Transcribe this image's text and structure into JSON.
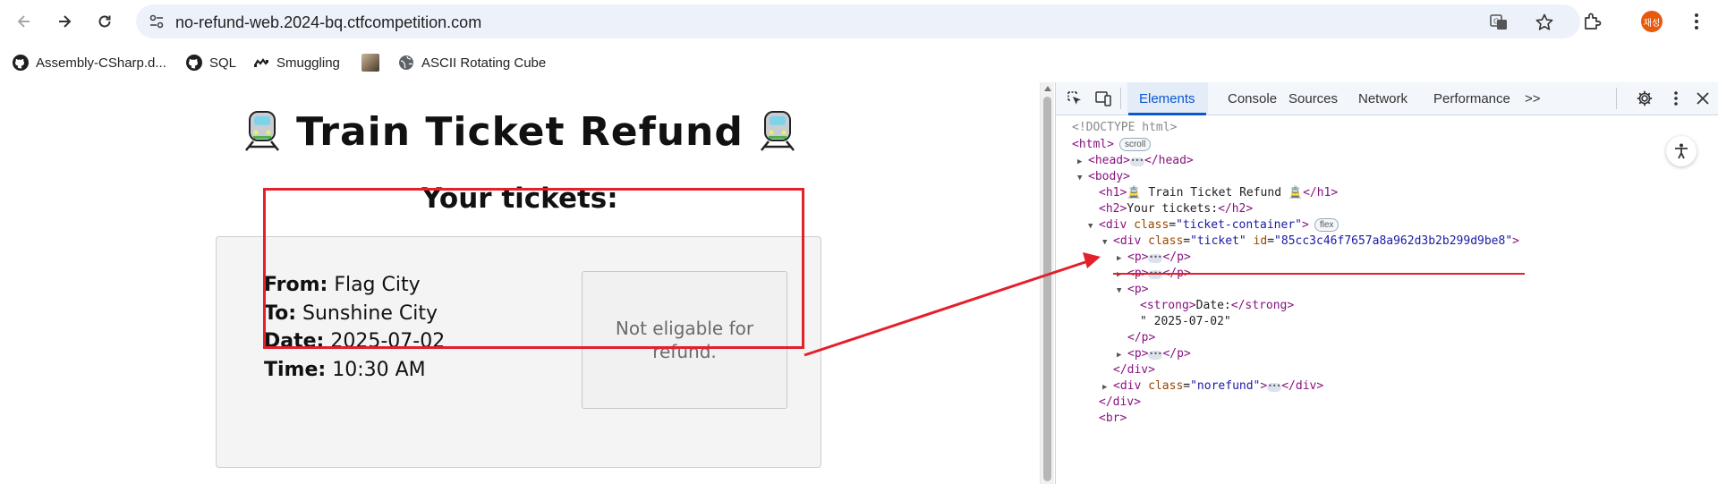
{
  "browser": {
    "url": "no-refund-web.2024-bq.ctfcompetition.com",
    "profile_initials": "재성"
  },
  "bookmarks": [
    {
      "label": "Assembly-CSharp.d...",
      "icon": "github-icon"
    },
    {
      "label": "SQL",
      "icon": "github-icon"
    },
    {
      "label": "Smuggling",
      "icon": "smuggling-icon"
    },
    {
      "label": "",
      "icon": "image-thumb-icon"
    },
    {
      "label": "ASCII Rotating Cube",
      "icon": "globe-icon"
    }
  ],
  "page": {
    "title": "Train Ticket Refund",
    "subtitle": "Your tickets:",
    "ticket": {
      "from_label": "From:",
      "from_value": "Flag City",
      "to_label": "To:",
      "to_value": "Sunshine City",
      "date_label": "Date:",
      "date_value": "2025-07-02",
      "time_label": "Time:",
      "time_value": "10:30 AM"
    },
    "norefund_text": "Not eligable for refund."
  },
  "devtools": {
    "tabs": [
      "Elements",
      "Console",
      "Sources",
      "Network",
      "Performance"
    ],
    "active_tab": "Elements",
    "more": ">>",
    "dom": {
      "doctype": "<!DOCTYPE html>",
      "html_open": "<html>",
      "scroll_pill": "scroll",
      "head": "<head>",
      "head_close": "</head>",
      "body_open": "<body>",
      "h1_open": "<h1>",
      "h1_text": " Train Ticket Refund ",
      "h1_close": "</h1>",
      "h2_open": "<h2>",
      "h2_text": "Your tickets:",
      "h2_close": "</h2>",
      "div_open": "<div ",
      "class_attr": "class",
      "eq": "=",
      "container_class": "\"ticket-container\"",
      "close_gt": ">",
      "flex_pill": "flex",
      "ticket_class": "\"ticket\"",
      "id_attr": " id",
      "ticket_id": "\"85cc3c46f7657a8a962d3b2b299d9be8\"",
      "p_open": "<p>",
      "p_close": "</p>",
      "strong_open": "<strong>",
      "strong_text": "Date:",
      "strong_close": "</strong>",
      "date_text": "\" 2025-07-02\"",
      "div_close": "</div>",
      "norefund_class": "\"norefund\"",
      "br": "<br>"
    }
  },
  "colors": {
    "accent": "#0b57d0",
    "annotation_red": "#e3202b",
    "tag": "#881280",
    "attr": "#994500",
    "attr_value": "#1a1aa6"
  }
}
